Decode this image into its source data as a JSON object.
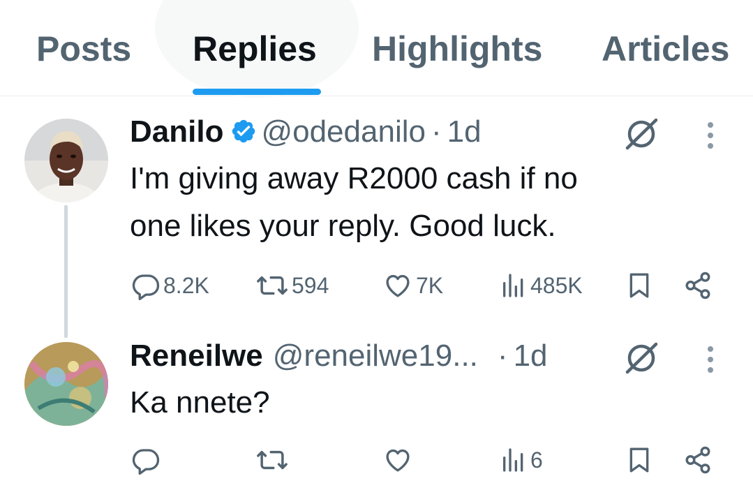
{
  "tabs": [
    {
      "label": "Posts"
    },
    {
      "label": "Replies"
    },
    {
      "label": "Highlights"
    },
    {
      "label": "Articles"
    }
  ],
  "active_tab": "Replies",
  "tweets": [
    {
      "name": "Danilo",
      "verified": true,
      "handle": "@odedanilo",
      "dot": "·",
      "time": "1d",
      "text": "I'm giving away R2000 cash if no\none likes your reply. Good luck.",
      "replies": "8.2K",
      "reposts": "594",
      "likes": "7K",
      "views": "485K"
    },
    {
      "name": "Reneilwe",
      "verified": false,
      "handle": "@reneilwe19...",
      "dot": "·",
      "time": "1d",
      "text": "Ka nnete?",
      "replies": "",
      "reposts": "",
      "likes": "",
      "views": "6"
    }
  ],
  "colors": {
    "accent": "#1d9bf0",
    "text_primary": "#0f1419",
    "text_secondary": "#536471",
    "divider": "#e6ecf0"
  },
  "icons": [
    "verified-badge-icon",
    "grok-icon",
    "more-icon",
    "reply-icon",
    "repost-icon",
    "like-icon",
    "views-icon",
    "bookmark-icon",
    "share-icon"
  ]
}
